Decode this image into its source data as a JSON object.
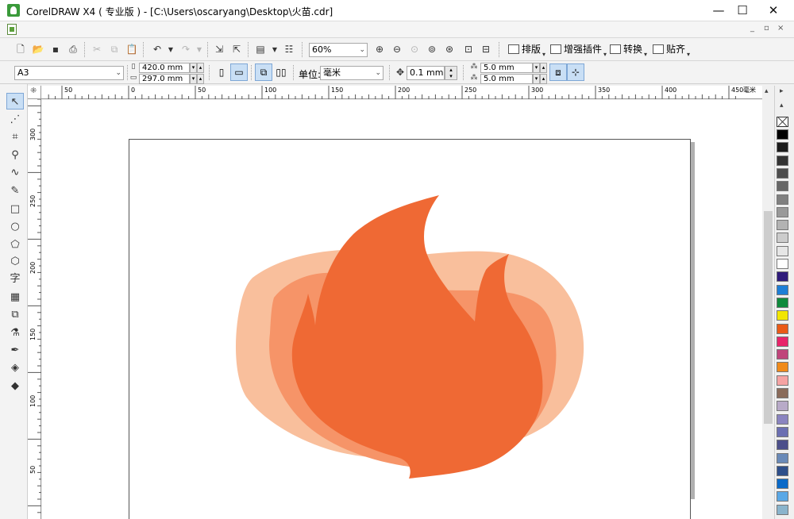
{
  "window": {
    "title": "CorelDRAW X4 ( 专业版 ) - [C:\\Users\\oscaryang\\Desktop\\火苗.cdr]",
    "minimize_glyph": "—",
    "maximize_glyph": "☐",
    "close_glyph": "✕"
  },
  "menubar": {
    "mdi_minimize": "_",
    "mdi_restore": "▫",
    "mdi_close": "×"
  },
  "toolbar": {
    "zoom_value": "60%",
    "menu_buttons": [
      {
        "label": "排版"
      },
      {
        "label": "增强插件"
      },
      {
        "label": "转换"
      },
      {
        "label": "贴齐"
      }
    ]
  },
  "property_bar": {
    "paper_size": "A3",
    "width": "420.0 mm",
    "height": "297.0 mm",
    "units_label": "单位:",
    "units_value": "毫米",
    "nudge": "0.1 mm",
    "dup_x": "5.0 mm",
    "dup_y": "5.0 mm"
  },
  "ruler": {
    "h_labels": [
      "50",
      "0",
      "50",
      "100",
      "150",
      "200",
      "250",
      "300",
      "350",
      "400",
      "450"
    ],
    "h_unit": "毫米",
    "v_labels": [
      "300",
      "250",
      "200",
      "150",
      "100",
      "50"
    ]
  },
  "colors": {
    "flame_outer": "#f9bf9c",
    "flame_middle": "#f69468",
    "flame_inner": "#ef6934",
    "selected_tool_bg": "#c9dff5"
  },
  "palette": {
    "swatches": [
      "#000000",
      "#1a1a1a",
      "#333333",
      "#4d4d4d",
      "#666666",
      "#808080",
      "#999999",
      "#b3b3b3",
      "#cccccc",
      "#e6e6e6",
      "#ffffff",
      "#2e1a7a",
      "#1e7fd6",
      "#0f8a3c",
      "#f2e600",
      "#ea5a17",
      "#e8246a",
      "#c0457b",
      "#f08a1a",
      "#f5a3a3",
      "#8a6b5a",
      "#b8aac8",
      "#8a84c0",
      "#6b6fb2",
      "#4c4f8a",
      "#6a8ab8",
      "#2e4f8a",
      "#0a6ac8",
      "#5aa8e6",
      "#8ab4cc"
    ]
  }
}
